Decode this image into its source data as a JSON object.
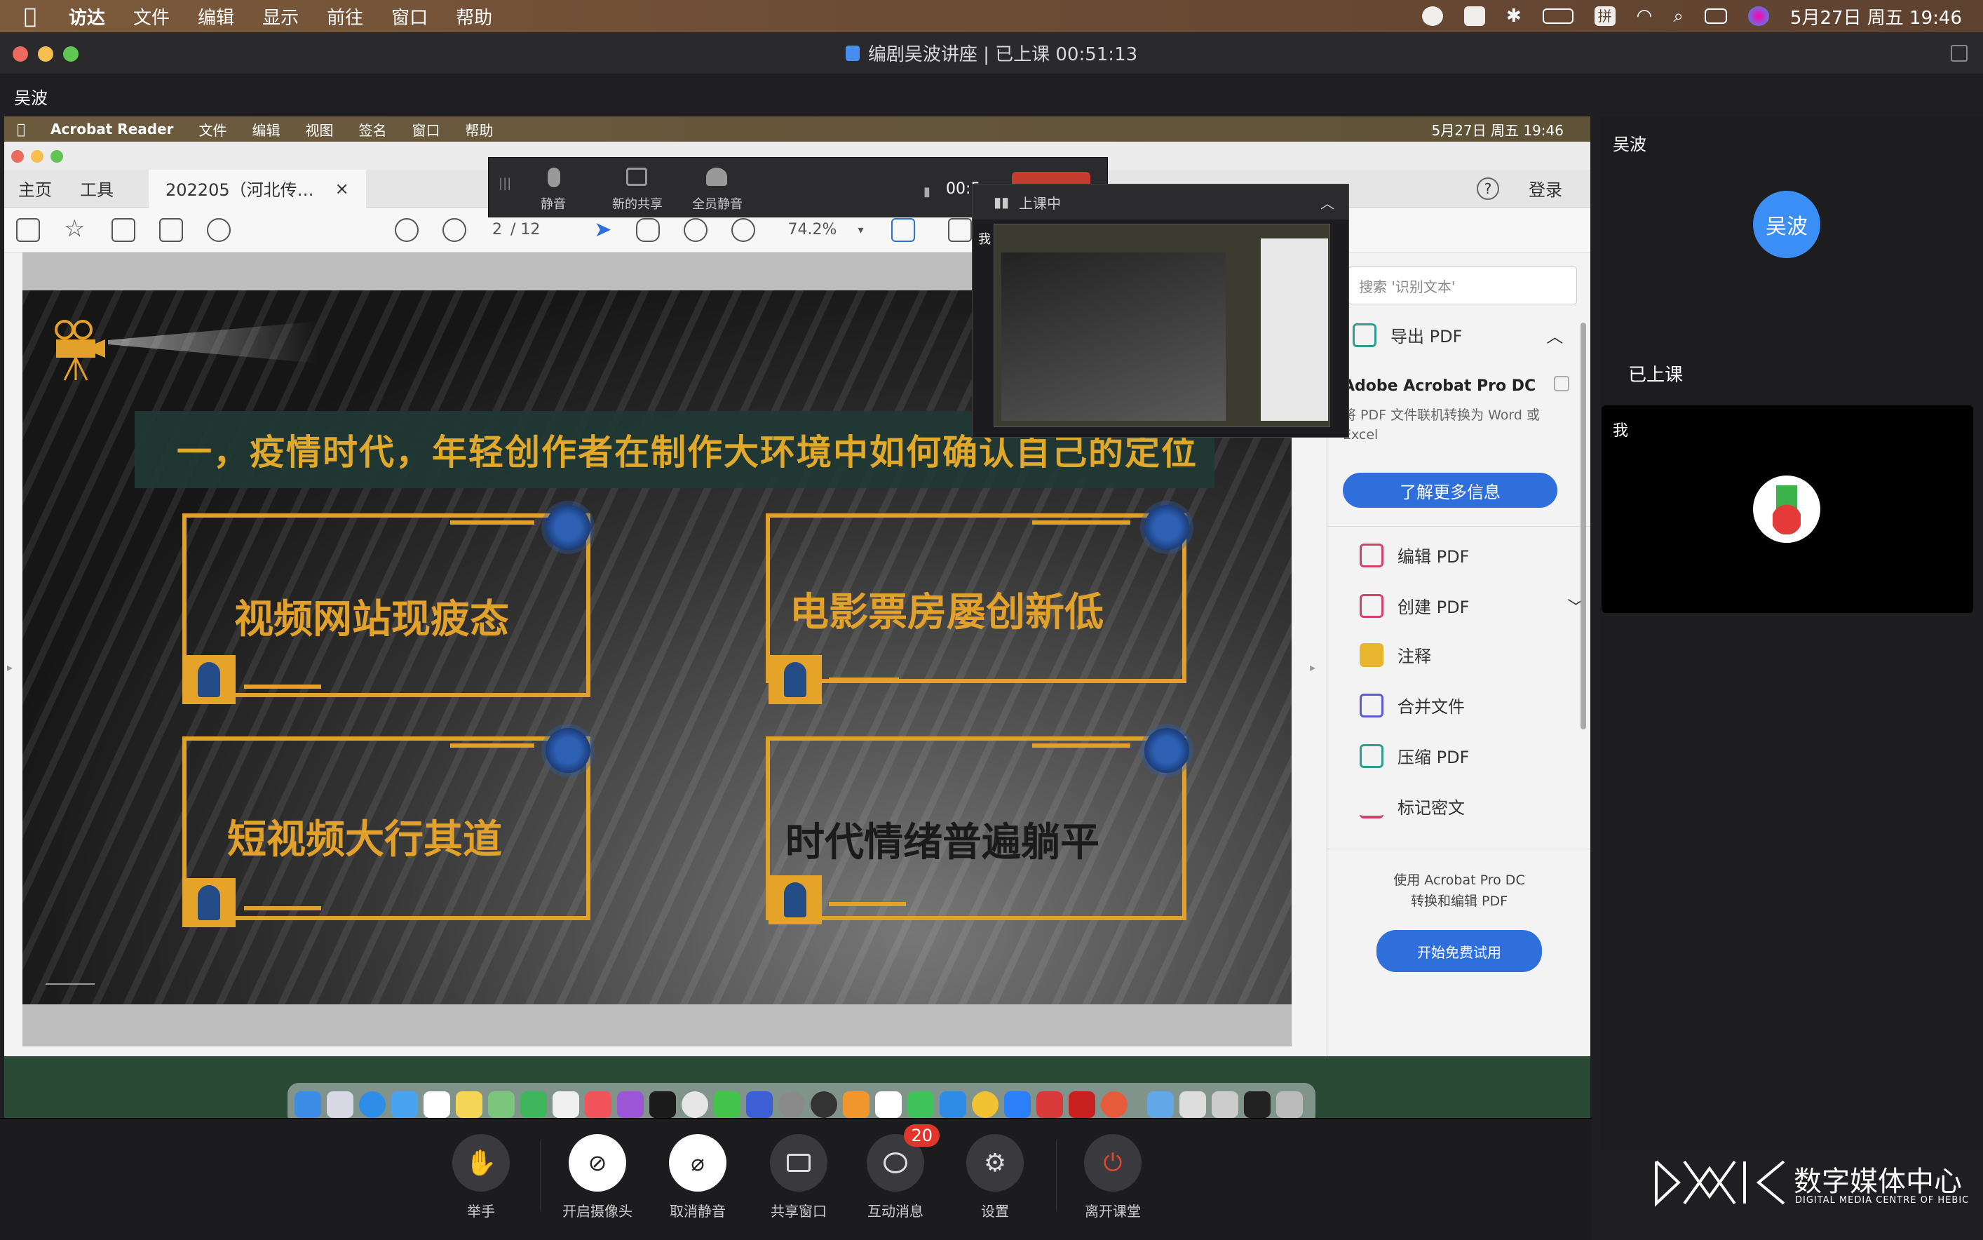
{
  "menubar": {
    "apple_icon": "apple-logo",
    "items": [
      "访达",
      "文件",
      "编辑",
      "显示",
      "前往",
      "窗口",
      "帮助"
    ],
    "datetime": "5月27日 周五 19:46",
    "status_icons": [
      "zoom-icon",
      "wps-icon",
      "bluetooth-icon",
      "battery-icon",
      "input-method-icon",
      "wifi-icon",
      "search-icon",
      "control-center-icon",
      "siri-icon"
    ],
    "input_method": "拼"
  },
  "meeting_window": {
    "title": "编剧吴波讲座 | 已上课 00:51:13",
    "sharer_name": "吴波"
  },
  "inner_menubar": {
    "app_name": "Acrobat Reader",
    "items": [
      "文件",
      "编辑",
      "视图",
      "签名",
      "窗口",
      "帮助"
    ],
    "datetime": "5月27日 周五 19:46"
  },
  "acrobat": {
    "tab_home": "主页",
    "tab_tools": "工具",
    "doc_tab": "202205（河北传…",
    "doc_tab_close": "×",
    "help": "?",
    "login": "登录",
    "page_current": "2",
    "page_total": "/ 12",
    "zoom": "74.2%",
    "search_placeholder": "搜索 '识别文本'",
    "export_pdf": "导出 PDF",
    "promo_title": "Adobe Acrobat Pro DC",
    "promo_desc": "将 PDF 文件联机转换为 Word 或 Excel",
    "promo_button": "了解更多信息",
    "tools": [
      "编辑 PDF",
      "创建 PDF",
      "注释",
      "合并文件",
      "压缩 PDF",
      "标记密文"
    ],
    "bottom_promo_line1": "使用 Acrobat Pro DC",
    "bottom_promo_line2": "转换和编辑 PDF",
    "trial_button": "开始免费试用"
  },
  "slide": {
    "heading": "一，疫情时代，年轻创作者在制作大环境中如何确认自己的定位",
    "boxes": [
      "视频网站现疲态",
      "电影票房屡创新低",
      "短视频大行其道",
      "时代情绪普遍躺平"
    ]
  },
  "floating_toolbar": {
    "mute": "静音",
    "new_share": "新的共享",
    "mute_all": "全员静音",
    "timer": "00:5",
    "preview_status": "上课中",
    "me": "我"
  },
  "participants": {
    "host_name": "吴波",
    "host_avatar": "吴波",
    "section_label": "已上课",
    "me_label": "我"
  },
  "controls": {
    "raise_hand": "举手",
    "camera": "开启摄像头",
    "unmute": "取消静音",
    "share": "共享窗口",
    "messages": "互动消息",
    "messages_badge": "20",
    "settings": "设置",
    "leave": "离开课堂"
  },
  "branding": {
    "logo_cn": "数字媒体中心",
    "logo_en": "DIGITAL MEDIA CENTRE OF HEBIC"
  }
}
